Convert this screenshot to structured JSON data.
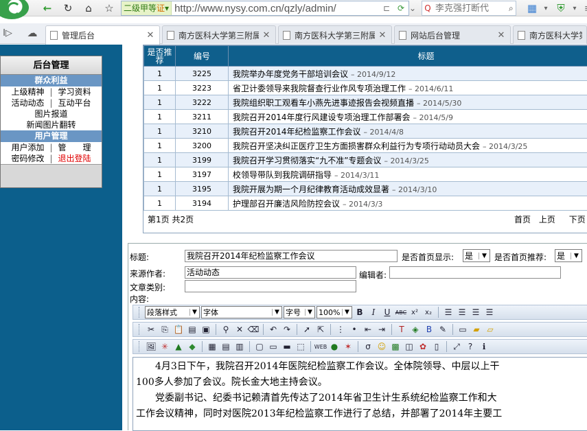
{
  "browser": {
    "mode_label": "二级甲等",
    "mode_badge": "证",
    "url": "http://www.nysy.com.cn/qzly/admin/",
    "search_placeholder": "李克强打断代",
    "tabs": [
      {
        "label": "管理后台",
        "active": true
      },
      {
        "label": "南方医科大学第三附属"
      },
      {
        "label": "南方医科大学第三附属"
      },
      {
        "label": "网站后台管理"
      },
      {
        "label": "南方医科大学第三"
      }
    ]
  },
  "sidebar": {
    "title": "后台管理",
    "sections": [
      {
        "label": "群众利益",
        "rows": [
          [
            "上级精神",
            "学习资料"
          ],
          [
            "活动动态",
            "互动平台"
          ],
          [
            "图片报道"
          ],
          [
            "新闻图片翻转"
          ]
        ]
      },
      {
        "label": "用户管理",
        "rows": [
          [
            "用户添加",
            "管　　理"
          ],
          [
            "密码修改",
            "退出登陆"
          ]
        ]
      }
    ]
  },
  "table": {
    "headers": {
      "recommend": "是否推荐",
      "id": "编号",
      "title": "标题"
    },
    "rows": [
      {
        "rec": "1",
        "id": "3225",
        "title": "我院举办年度党务干部培训会议",
        "date": "2014/9/12"
      },
      {
        "rec": "1",
        "id": "3223",
        "title": "省卫计委领导来我院督查行业作风专项治理工作",
        "date": "2014/6/11"
      },
      {
        "rec": "1",
        "id": "3222",
        "title": "我院组织职工观看车小燕先进事迹报告会视频直播",
        "date": "2014/5/30"
      },
      {
        "rec": "1",
        "id": "3211",
        "title": "我院召开2014年度行风建设专项治理工作部署会",
        "date": "2014/5/9"
      },
      {
        "rec": "1",
        "id": "3210",
        "title": "我院召开2014年纪检监察工作会议",
        "date": "2014/4/8"
      },
      {
        "rec": "1",
        "id": "3200",
        "title": "我院召开坚决纠正医疗卫生方面损害群众利益行为专项行动动员大会",
        "date": "2014/3/25"
      },
      {
        "rec": "1",
        "id": "3199",
        "title": "我院召开学习贯彻落实“九不准”专题会议",
        "date": "2014/3/25"
      },
      {
        "rec": "1",
        "id": "3197",
        "title": "校领导带队到我院调研指导",
        "date": "2014/3/11"
      },
      {
        "rec": "1",
        "id": "3195",
        "title": "我院开展为期一个月纪律教育活动成效显著",
        "date": "2014/3/10"
      },
      {
        "rec": "1",
        "id": "3194",
        "title": "护理部召开廉洁风险防控会议",
        "date": "2014/3/3"
      }
    ],
    "pager": {
      "status": "第1页 共2页",
      "first": "首页",
      "prev": "上页",
      "next": "下页"
    }
  },
  "form": {
    "title_label": "标题:",
    "title_value": "我院召开2014年纪检监察工作会议",
    "home_show_label": "是否首页显示:",
    "home_show_value": "是",
    "home_rec_label": "是否首页推荐:",
    "home_rec_value": "是",
    "source_label": "来源作者:",
    "source_value": "活动动态",
    "editor_label": "编辑者:",
    "editor_value": "",
    "category_label": "文章类别:",
    "category_value": "",
    "content_label": "内容:",
    "toolbar": {
      "paragraph": "段落样式",
      "font": "字体",
      "size": "字号",
      "zoom": "100%"
    },
    "content_lines": [
      "　　4月3日下午，我院召开2014年医院纪检监察工作会议。全体院领导、中层以上干",
      "100多人参加了会议。院长金大地主持会议。",
      "　　党委副书记、纪委书记赖清首先传达了2014年省卫生计生系统纪检监察工作和大",
      "工作会议精神，同时对医院2013年纪检监察工作进行了总结，并部署了2014年主要工"
    ]
  }
}
